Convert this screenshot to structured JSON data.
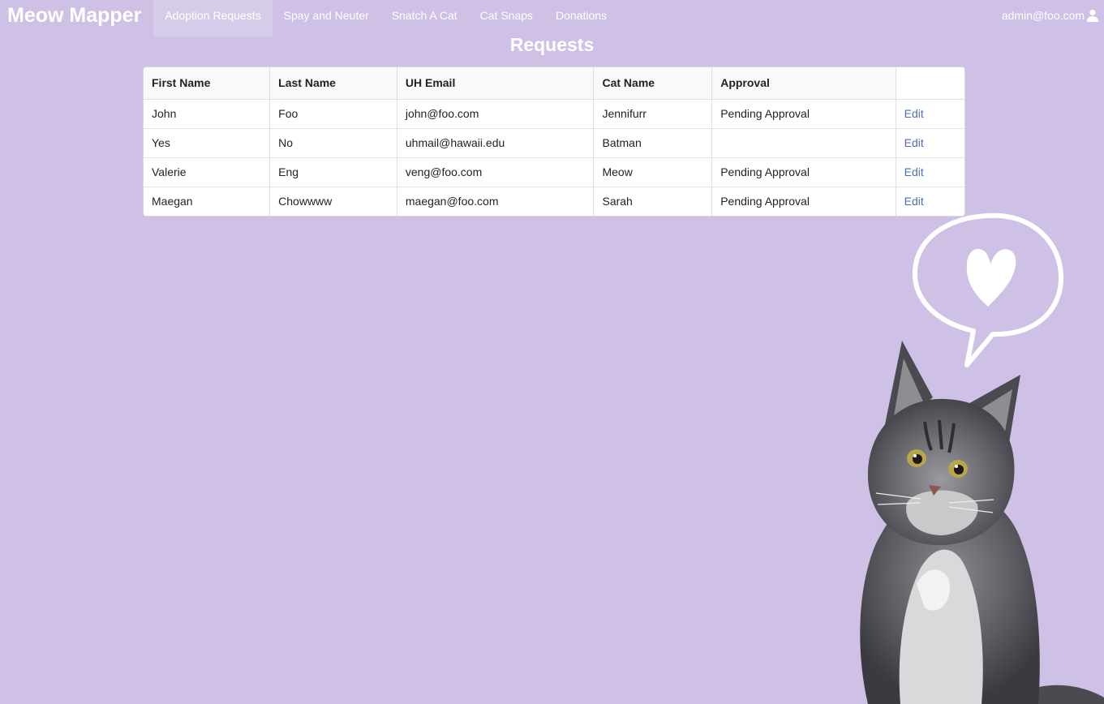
{
  "nav": {
    "brand": "Meow Mapper",
    "items": [
      {
        "label": "Adoption Requests",
        "active": true
      },
      {
        "label": "Spay and Neuter",
        "active": false
      },
      {
        "label": "Snatch A Cat",
        "active": false
      },
      {
        "label": "Cat Snaps",
        "active": false
      },
      {
        "label": "Donations",
        "active": false
      }
    ],
    "user": "admin@foo.com",
    "user_icon": "user-icon"
  },
  "page": {
    "title": "Requests"
  },
  "table": {
    "headers": [
      "First Name",
      "Last Name",
      "UH Email",
      "Cat Name",
      "Approval"
    ],
    "rows": [
      {
        "first": "John",
        "last": "Foo",
        "email": "john@foo.com",
        "cat": "Jennifurr",
        "approval": "Pending Approval",
        "action": "Edit"
      },
      {
        "first": "Yes",
        "last": "No",
        "email": "uhmail@hawaii.edu",
        "cat": "Batman",
        "approval": "",
        "action": "Edit"
      },
      {
        "first": "Valerie",
        "last": "Eng",
        "email": "veng@foo.com",
        "cat": "Meow",
        "approval": "Pending Approval",
        "action": "Edit"
      },
      {
        "first": "Maegan",
        "last": "Chowwww",
        "email": "maegan@foo.com",
        "cat": "Sarah",
        "approval": "Pending Approval",
        "action": "Edit"
      }
    ]
  },
  "colors": {
    "background": "#cfc0e6",
    "link": "#4a6fb5"
  },
  "decoration": {
    "bubble_icon": "heart-speech-bubble",
    "cat_image": "maine-coon-kitten"
  }
}
